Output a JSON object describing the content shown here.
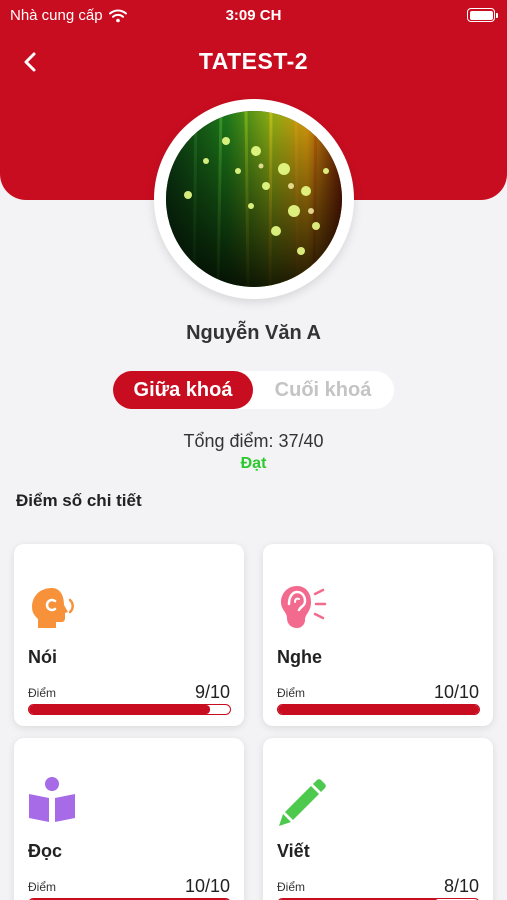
{
  "status_bar": {
    "carrier": "Nhà cung cấp",
    "time": "3:09 CH"
  },
  "nav": {
    "title": "TATEST-2"
  },
  "profile": {
    "name": "Nguyễn Văn A"
  },
  "tabs": [
    {
      "label": "Giữa khoá",
      "active": true
    },
    {
      "label": "Cuối khoá",
      "active": false
    }
  ],
  "summary": {
    "total": "Tổng điểm: 37/40",
    "result": "Đạt"
  },
  "section_title": "Điểm số chi tiết",
  "colors": {
    "brand": "#c90d20",
    "pass": "#2dc92d"
  },
  "skills": [
    {
      "name": "Nói",
      "score_label": "Điểm",
      "score": "9/10",
      "progress": 0.9,
      "icon": "speaking-head-icon",
      "icon_color": "#f7923a"
    },
    {
      "name": "Nghe",
      "score_label": "Điểm",
      "score": "10/10",
      "progress": 1.0,
      "icon": "ear-icon",
      "icon_color": "#f26a8d"
    },
    {
      "name": "Đọc",
      "score_label": "Điểm",
      "score": "10/10",
      "progress": 1.0,
      "icon": "reading-person-icon",
      "icon_color": "#a86be8"
    },
    {
      "name": "Viết",
      "score_label": "Điểm",
      "score": "8/10",
      "progress": 0.8,
      "icon": "pencil-icon",
      "icon_color": "#4dc94d"
    }
  ]
}
